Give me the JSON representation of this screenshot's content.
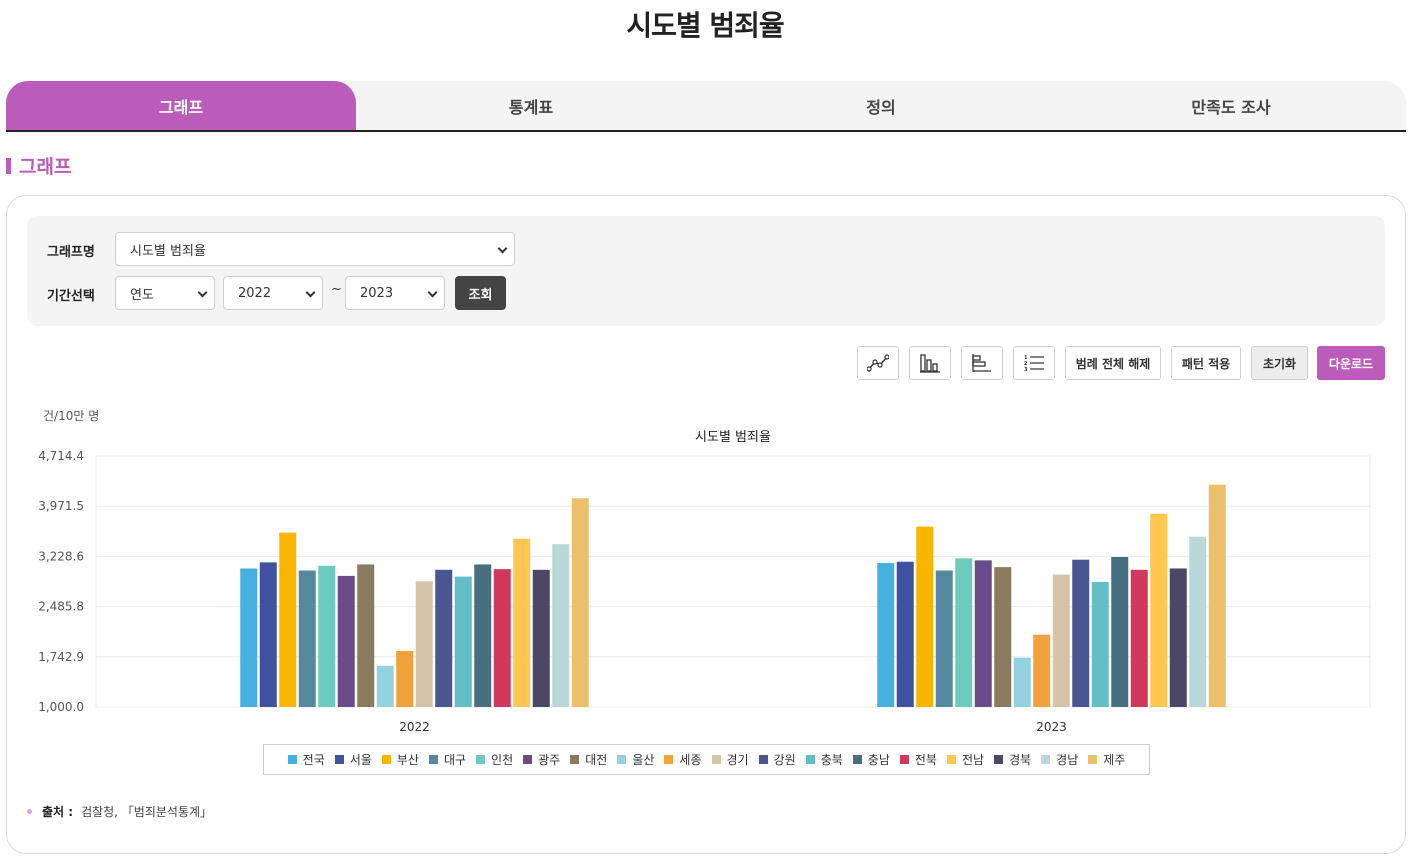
{
  "page": {
    "title": "시도별 범죄율"
  },
  "tabs": [
    {
      "label": "그래프",
      "active": true
    },
    {
      "label": "통계표",
      "active": false
    },
    {
      "label": "정의",
      "active": false
    },
    {
      "label": "만족도 조사",
      "active": false
    }
  ],
  "section": {
    "title": "그래프"
  },
  "filter": {
    "graph_label": "그래프명",
    "graph_value": "시도별 범죄율",
    "period_label": "기간선택",
    "period_unit": "연도",
    "from_year": "2022",
    "tilde": "~",
    "to_year": "2023",
    "query_button": "조회"
  },
  "toolbar": {
    "icons": [
      "line-chart-icon",
      "bar-chart-icon",
      "horizontal-bar-icon",
      "numbered-list-icon"
    ],
    "legend_off": "범례 전체 해제",
    "pattern": "패턴 적용",
    "reset": "초기화",
    "download": "다운로드"
  },
  "colors": {
    "accent": "#bb5cbb",
    "dark_button": "#444444"
  },
  "source": {
    "label": "출처 :",
    "text": "검찰청, 「범죄분석통계」"
  },
  "chart_data": {
    "type": "bar",
    "title": "시도별 범죄율",
    "unit_label": "건/10만 명",
    "categories": [
      "2022",
      "2023"
    ],
    "ylim": [
      1000.0,
      4714.4
    ],
    "yticks": [
      "1,000.0",
      "1,742.9",
      "2,485.8",
      "3,228.6",
      "3,971.5",
      "4,714.4"
    ],
    "grid": true,
    "legend_position": "bottom",
    "series": [
      {
        "name": "전국",
        "color": "#46b0e0",
        "values": [
          3050,
          3130
        ]
      },
      {
        "name": "서울",
        "color": "#3f52a0",
        "values": [
          3140,
          3150
        ]
      },
      {
        "name": "부산",
        "color": "#f7b500",
        "values": [
          3580,
          3670
        ]
      },
      {
        "name": "대구",
        "color": "#5688a0",
        "values": [
          3020,
          3020
        ]
      },
      {
        "name": "인천",
        "color": "#6ccbbe",
        "values": [
          3090,
          3200
        ]
      },
      {
        "name": "광주",
        "color": "#6b4c8a",
        "values": [
          2940,
          3170
        ]
      },
      {
        "name": "대전",
        "color": "#8a7a5e",
        "values": [
          3110,
          3070
        ]
      },
      {
        "name": "울산",
        "color": "#93d3e0",
        "values": [
          1610,
          1730
        ]
      },
      {
        "name": "세종",
        "color": "#f2a23a",
        "values": [
          1830,
          2070
        ]
      },
      {
        "name": "경기",
        "color": "#d5c4a8",
        "values": [
          2860,
          2960
        ]
      },
      {
        "name": "강원",
        "color": "#4a5690",
        "values": [
          3030,
          3180
        ]
      },
      {
        "name": "충북",
        "color": "#63bec6",
        "values": [
          2930,
          2850
        ]
      },
      {
        "name": "충남",
        "color": "#476f80",
        "values": [
          3110,
          3220
        ]
      },
      {
        "name": "전북",
        "color": "#d0395b",
        "values": [
          3040,
          3030
        ]
      },
      {
        "name": "전남",
        "color": "#ffc750",
        "values": [
          3490,
          3860
        ]
      },
      {
        "name": "경북",
        "color": "#4a4866",
        "values": [
          3030,
          3050
        ]
      },
      {
        "name": "경남",
        "color": "#b9d7d8",
        "values": [
          3410,
          3520
        ]
      },
      {
        "name": "제주",
        "color": "#ecc06b",
        "values": [
          4090,
          4290
        ]
      }
    ]
  }
}
